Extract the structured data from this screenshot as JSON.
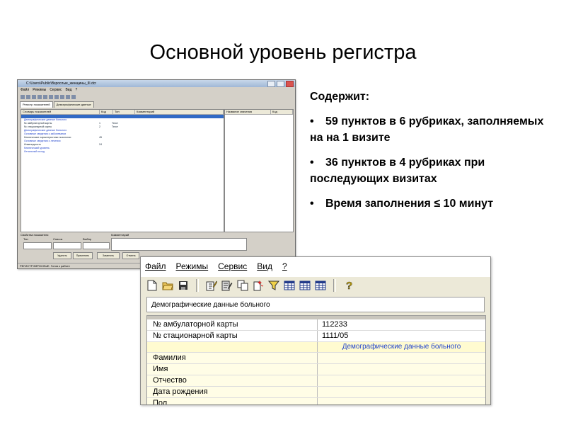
{
  "title": "Основной уровень регистра",
  "info": {
    "heading": "Содержит:",
    "bullets": [
      {
        "marker": "•",
        "text": "59 пунктов в 6 рубриках, заполняемых на  на 1 визите"
      },
      {
        "marker": "•",
        "text": "36 пунктов в 4 рубриках при последующих визитах"
      },
      {
        "marker": "•",
        "text": "Время заполнения ≤ 10 минут"
      }
    ]
  },
  "small_window": {
    "title": "C:\\Users\\Public\\Взрослые_женщины_III.dcr",
    "menu": [
      "Файл",
      "Режимы",
      "Сервис",
      "Вид",
      "?"
    ],
    "tabs": [
      "Регистр показателей",
      "Демографические данные"
    ],
    "grid_headers": [
      "Словарь показателей",
      "Код",
      "Тип",
      "Комментарий"
    ],
    "right_headers": [
      "Название значения",
      "Код"
    ],
    "rows": [
      {
        "name": "Демографические данные больного",
        "code": "",
        "type": "",
        "blue": true
      },
      {
        "name": "№ амбулаторной карты",
        "code": "1",
        "type": "Текст",
        "blue": false
      },
      {
        "name": "№ стационарной карты",
        "code": "2",
        "type": "Текст",
        "blue": false
      },
      {
        "name": "Демографические данные больного",
        "code": "",
        "type": "",
        "blue": true
      },
      {
        "name": "Основные сведения о заболевании",
        "code": "",
        "type": "",
        "blue": true
      },
      {
        "name": "Клинические характеристики нозологии",
        "code": "45",
        "type": "",
        "blue": false
      },
      {
        "name": "Основные сведения о лечении",
        "code": "",
        "type": "",
        "blue": true
      },
      {
        "name": "Инвалидность",
        "code": "24",
        "type": "",
        "blue": false
      },
      {
        "name": "Клинический уровень",
        "code": "",
        "type": "",
        "blue": true
      },
      {
        "name": "Летальный исход",
        "code": "",
        "type": "",
        "blue": true
      }
    ],
    "bottom_labels": [
      "Свойства показателя",
      "Тип",
      "Список",
      "Выбор",
      "Комментарий"
    ],
    "bottom_buttons": [
      "Удалить",
      "Применить",
      "Заменить",
      "Отмена"
    ],
    "status": "РЕГИСТР ВЗРОСЛЫЕ. Готов к работе"
  },
  "zoom_window": {
    "menu": [
      "Файл",
      "Режимы",
      "Сервис",
      "Вид",
      "?"
    ],
    "section_title": "Демографические данные больного",
    "rows": [
      {
        "key": "№ амбулаторной карты",
        "value": "112233"
      },
      {
        "key": "№ стационарной карты",
        "value": "1111/05"
      },
      {
        "key": "",
        "value": "Демографические данные больного",
        "section": true
      },
      {
        "key": "Фамилия",
        "value": ""
      },
      {
        "key": "Имя",
        "value": ""
      },
      {
        "key": "Отчество",
        "value": ""
      },
      {
        "key": "Дата рождения",
        "value": ""
      },
      {
        "key": "Пол",
        "value": ""
      }
    ]
  }
}
